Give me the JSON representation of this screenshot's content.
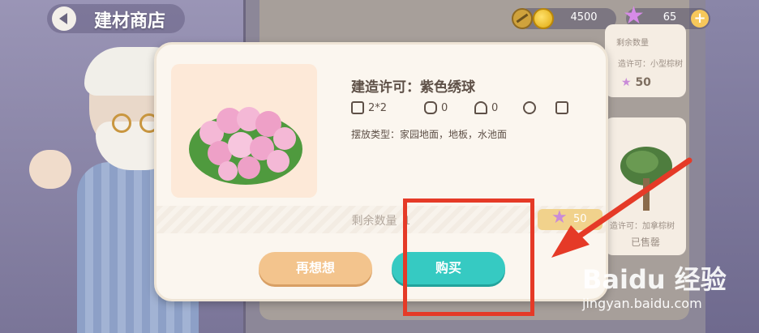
{
  "header": {
    "title": "建材商店"
  },
  "currency": {
    "coins": "4500",
    "stars": "65",
    "plus": "+"
  },
  "side_cards": [
    {
      "label1": "剩余数量",
      "label2": "造许可：小型棕树",
      "price": "50"
    },
    {
      "label": "造许可：加拿棕树",
      "status": "已售罄"
    }
  ],
  "dialog": {
    "item_name": "建造许可：紫色绣球",
    "size": "2*2",
    "stat_a": "0",
    "stat_b": "0",
    "placement": "摆放类型：家园地面，地板，水池面",
    "remaining_label": "剩余数量",
    "remaining_value": "1",
    "price": "50",
    "cancel_label": "再想想",
    "buy_label": "购买"
  },
  "watermark": {
    "logo": "Baidu 经验",
    "url": "jingyan.baidu.com"
  },
  "colors": {
    "buy": "#36cac2",
    "cancel": "#f3c48d",
    "highlight": "#e53a27"
  }
}
